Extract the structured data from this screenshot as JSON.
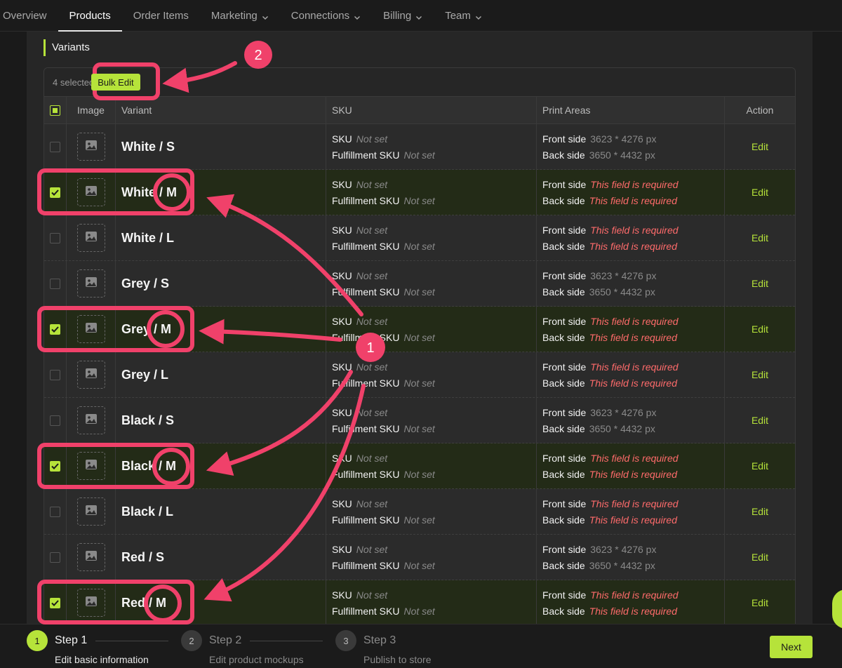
{
  "nav": {
    "items": [
      {
        "label": "Overview",
        "active": false,
        "dropdown": false
      },
      {
        "label": "Products",
        "active": true,
        "dropdown": false
      },
      {
        "label": "Order Items",
        "active": false,
        "dropdown": false
      },
      {
        "label": "Marketing",
        "active": false,
        "dropdown": true
      },
      {
        "label": "Connections",
        "active": false,
        "dropdown": true
      },
      {
        "label": "Billing",
        "active": false,
        "dropdown": true
      },
      {
        "label": "Team",
        "active": false,
        "dropdown": true
      }
    ]
  },
  "section": {
    "title": "Variants"
  },
  "bulk": {
    "selected_text": "4 selected",
    "button_label": "Bulk Edit"
  },
  "columns": {
    "image": "Image",
    "variant": "Variant",
    "sku": "SKU",
    "print_areas": "Print Areas",
    "action": "Action"
  },
  "labels": {
    "sku": "SKU",
    "fulfillment_sku": "Fulfillment SKU",
    "not_set": "Not set",
    "front_side": "Front side",
    "back_side": "Back side",
    "required": "This field is required",
    "edit": "Edit",
    "front_dims": "3623 * 4276 px",
    "back_dims": "3650 * 4432 px"
  },
  "rows": [
    {
      "variant": "White / S",
      "selected": false,
      "print_ok": true
    },
    {
      "variant": "White / M",
      "selected": true,
      "print_ok": false
    },
    {
      "variant": "White / L",
      "selected": false,
      "print_ok": false
    },
    {
      "variant": "Grey / S",
      "selected": false,
      "print_ok": true
    },
    {
      "variant": "Grey / M",
      "selected": true,
      "print_ok": false
    },
    {
      "variant": "Grey / L",
      "selected": false,
      "print_ok": false
    },
    {
      "variant": "Black / S",
      "selected": false,
      "print_ok": true
    },
    {
      "variant": "Black / M",
      "selected": true,
      "print_ok": false
    },
    {
      "variant": "Black / L",
      "selected": false,
      "print_ok": false
    },
    {
      "variant": "Red / S",
      "selected": false,
      "print_ok": true
    },
    {
      "variant": "Red / M",
      "selected": true,
      "print_ok": false
    }
  ],
  "steps": [
    {
      "num": "1",
      "title": "Step 1",
      "desc": "Edit basic information",
      "current": true
    },
    {
      "num": "2",
      "title": "Step 2",
      "desc": "Edit product mockups",
      "current": false
    },
    {
      "num": "3",
      "title": "Step 3",
      "desc": "Publish to store",
      "current": false
    }
  ],
  "footer": {
    "next_label": "Next"
  },
  "annotations": {
    "badge_1": "1",
    "badge_2": "2",
    "color": "#f0416a"
  },
  "colors": {
    "accent": "#b6e33a",
    "error": "#ff6b6b",
    "annotation": "#f0416a"
  }
}
